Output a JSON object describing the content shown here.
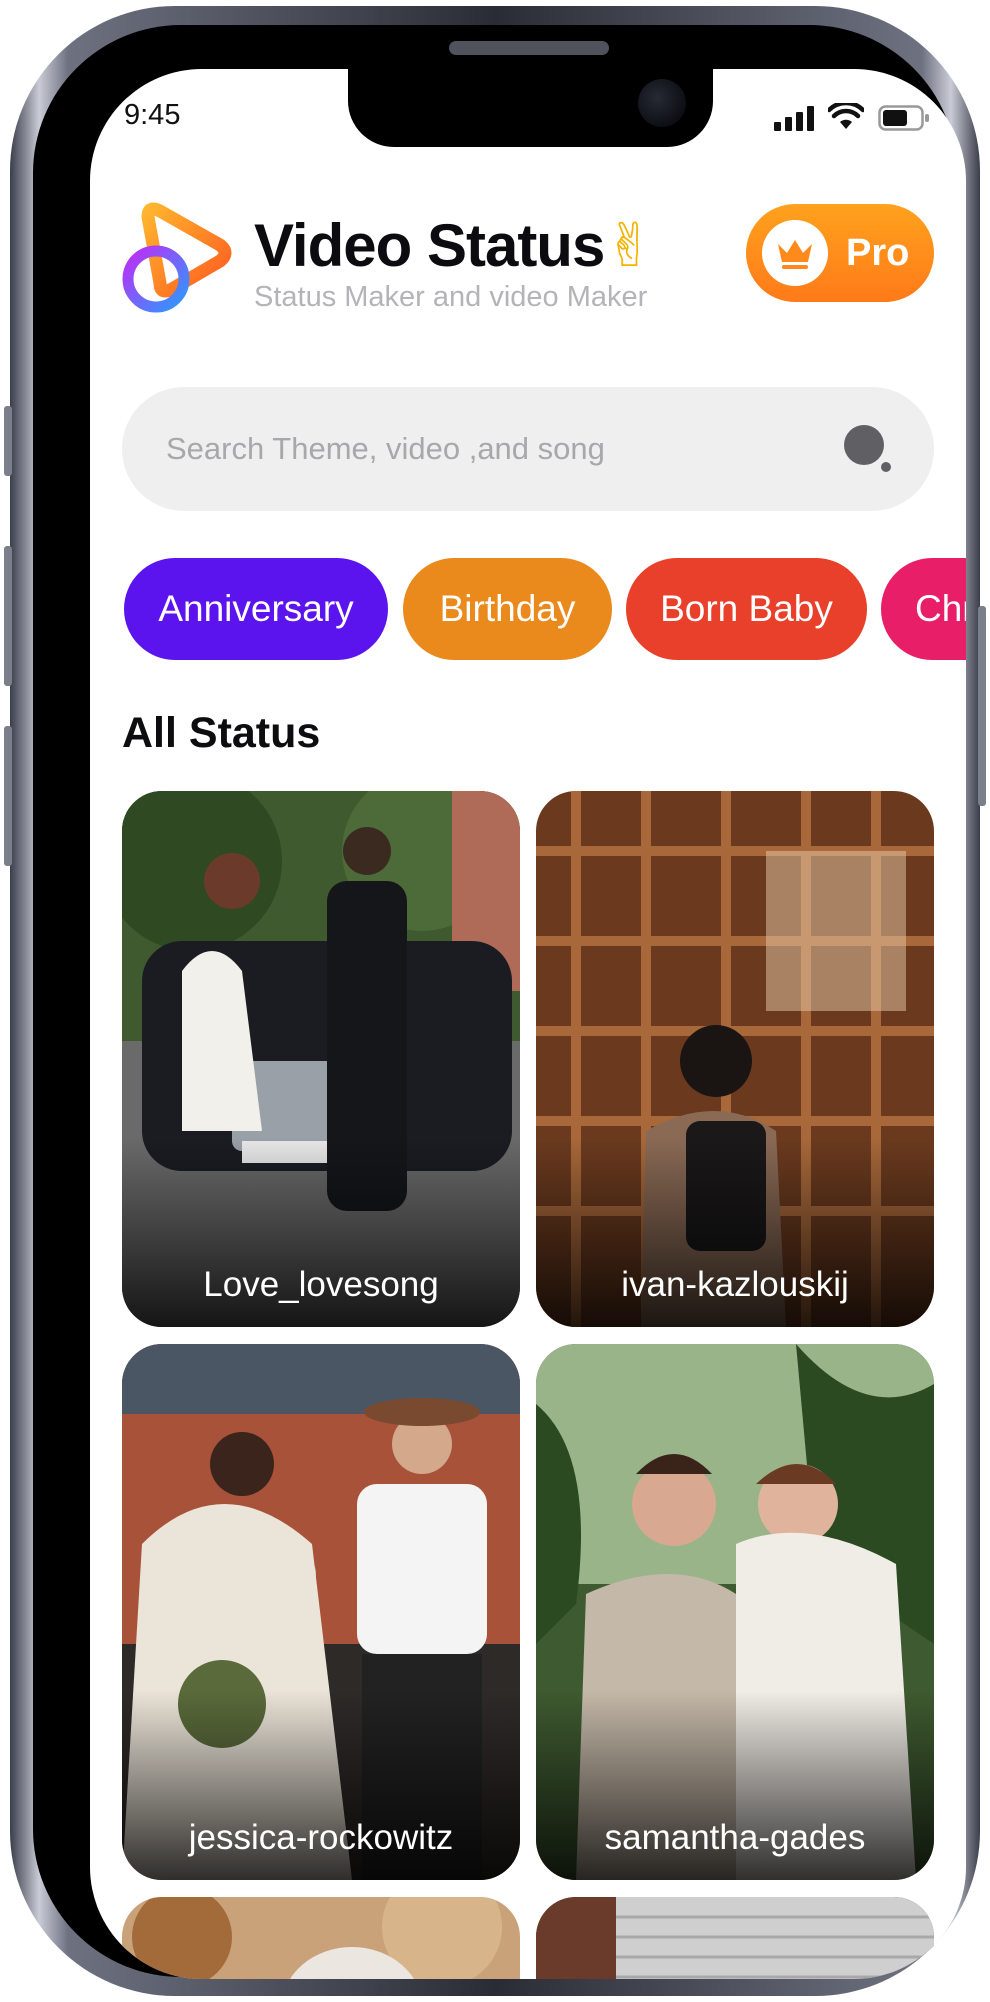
{
  "status_bar": {
    "time": "9:45"
  },
  "header": {
    "title": "Video Status",
    "title_emoji": "✌",
    "subtitle": "Status Maker and video Maker",
    "pro_label": "Pro"
  },
  "search": {
    "placeholder": "Search Theme, video ,and song",
    "value": ""
  },
  "categories": [
    {
      "label": "Anniversary",
      "color": "#5B14EE"
    },
    {
      "label": "Birthday",
      "color": "#EB8A1C"
    },
    {
      "label": "Born Baby",
      "color": "#E8402A"
    },
    {
      "label": "Christmas",
      "color": "#E81E69"
    }
  ],
  "section": {
    "title": "All Status"
  },
  "cards": [
    {
      "label": "Love_lovesong"
    },
    {
      "label": "ivan-kazlouskij"
    },
    {
      "label": "jessica-rockowitz"
    },
    {
      "label": "samantha-gades"
    }
  ],
  "colors": {
    "accent_orange": "#FF8A1C",
    "brand_purple": "#5B14EE"
  },
  "icons": [
    "app-logo-icon",
    "crown-icon",
    "search-icon",
    "signal-icon",
    "wifi-icon",
    "battery-icon"
  ]
}
